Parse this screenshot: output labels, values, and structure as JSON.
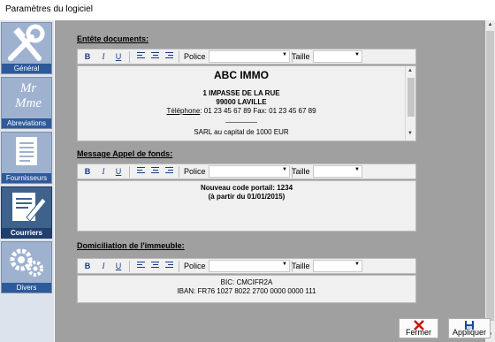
{
  "window": {
    "title": "Paramètres du logiciel"
  },
  "sidebar": {
    "items": [
      {
        "label": "Général",
        "icon": "tools-icon",
        "active": false
      },
      {
        "label": "Abreviations",
        "icon": "mr-mme-icon",
        "icon_text_1": "Mr",
        "icon_text_2": "Mme",
        "active": false
      },
      {
        "label": "Fournisseurs",
        "icon": "document-icon",
        "active": false
      },
      {
        "label": "Courriers",
        "icon": "letter-pen-icon",
        "active": true
      },
      {
        "label": "Divers",
        "icon": "gears-icon",
        "active": false
      }
    ]
  },
  "toolbar": {
    "bold": "B",
    "italic": "I",
    "underline": "U",
    "font_label": "Police",
    "size_label": "Taille"
  },
  "sections": {
    "header": {
      "title": "Entête documents:",
      "company": "ABC IMMO",
      "address1": "1 IMPASSE DE LA RUE",
      "address2": "99000 LAVILLE",
      "phone_label": "Téléphone",
      "phone_rest": ": 01 23 45 67 89  Fax: 01 23 45 67 89",
      "divider": "________",
      "capital": "SARL au capital de 1000 EUR"
    },
    "message": {
      "title": "Message Appel de fonds:",
      "line1": "Nouveau code portail: 1234",
      "line2": "(à partir du 01/01/2015)"
    },
    "domiciliation": {
      "title": "Domiciliation de l'immeuble:",
      "bic": "BIC:  CMCIFR2A",
      "iban": "IBAN: FR76 1027 8022 2700 0000 0000 111"
    }
  },
  "buttons": {
    "close": "Fermer",
    "apply": "Appliquer"
  },
  "colors": {
    "close_icon": "#cc1111",
    "apply_icon": "#1a4a9a",
    "nav_label": "#2d5a9b",
    "nav_active": "#3f628d"
  }
}
